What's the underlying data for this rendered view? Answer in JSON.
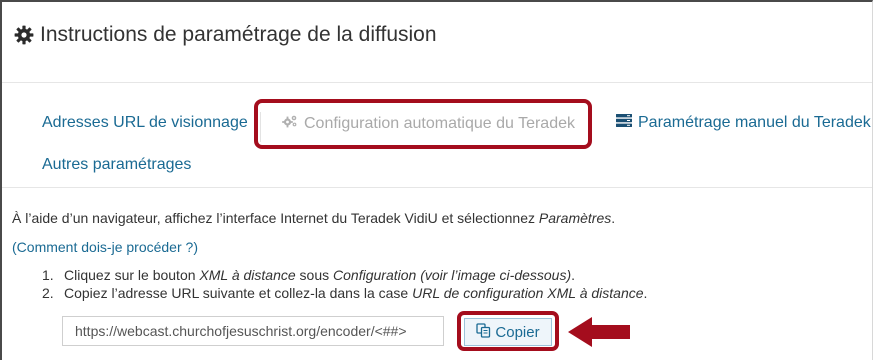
{
  "header": {
    "title": "Instructions de paramétrage de la diffusion",
    "icon": "gear-icon"
  },
  "tabs": [
    {
      "label": "Adresses URL de visionnage",
      "state": "link"
    },
    {
      "label": "Configuration automatique du Teradek",
      "state": "active",
      "icon": "gears-icon"
    },
    {
      "label": "Paramétrage manuel du Teradek",
      "state": "link",
      "icon": "server-icon"
    },
    {
      "label": "Autres paramétrages",
      "state": "link"
    }
  ],
  "content": {
    "intro_prefix": "À l’aide d’un navigateur, affichez l’interface Internet du Teradek VidiU et sélectionnez ",
    "intro_em": "Paramètres",
    "intro_suffix": ".",
    "how_link": "Comment dois-je procéder ?",
    "how_open": "(",
    "how_close": ")",
    "step1_num": "1.",
    "step1_a": "Cliquez sur le bouton ",
    "step1_em1": "XML à distance",
    "step1_b": " sous ",
    "step1_em2": "Configuration (voir l’image ci-dessous)",
    "step1_c": ".",
    "step2_num": "2.",
    "step2_a": "Copiez l’adresse URL suivante et collez-la dans la case ",
    "step2_em": "URL de configuration XML à distance",
    "step2_c": "."
  },
  "url_field": {
    "value": "https://webcast.churchofjesuschrist.org/encoder/<##>"
  },
  "copy_button": {
    "label": "Copier",
    "icon": "copy-icon"
  },
  "colors": {
    "link": "#1a6a93",
    "highlight": "#a40d1d",
    "disabled": "#a9a9a9"
  }
}
